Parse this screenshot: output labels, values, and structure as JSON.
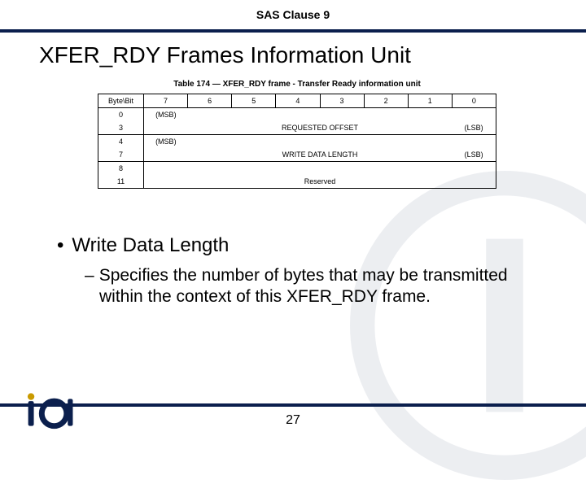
{
  "header": {
    "clause": "SAS Clause 9"
  },
  "title": "XFER_RDY Frames Information Unit",
  "table": {
    "caption": "Table 174 — XFER_RDY frame - Transfer Ready information unit",
    "corner": "Byte\\Bit",
    "bits": [
      "7",
      "6",
      "5",
      "4",
      "3",
      "2",
      "1",
      "0"
    ],
    "rows": [
      {
        "byte_start": "0",
        "byte_end": "3",
        "msb": "(MSB)",
        "field": "REQUESTED OFFSET",
        "lsb": "(LSB)"
      },
      {
        "byte_start": "4",
        "byte_end": "7",
        "msb": "(MSB)",
        "field": "WRITE DATA LENGTH",
        "lsb": "(LSB)"
      },
      {
        "byte_start": "8",
        "byte_end": "11",
        "msb": "",
        "field": "Reserved",
        "lsb": ""
      }
    ]
  },
  "bullets": {
    "b1": "Write Data Length",
    "b2": "Specifies the number of bytes that may be transmitted within the context of this XFER_RDY frame."
  },
  "footer": {
    "page": "27"
  },
  "chart_data": {
    "type": "table",
    "title": "Table 174 — XFER_RDY frame - Transfer Ready information unit",
    "columns": [
      "Byte\\Bit",
      "7",
      "6",
      "5",
      "4",
      "3",
      "2",
      "1",
      "0"
    ],
    "fields": [
      {
        "bytes": "0-3",
        "name": "REQUESTED OFFSET",
        "msb": true,
        "lsb": true
      },
      {
        "bytes": "4-7",
        "name": "WRITE DATA LENGTH",
        "msb": true,
        "lsb": true
      },
      {
        "bytes": "8-11",
        "name": "Reserved",
        "msb": false,
        "lsb": false
      }
    ]
  }
}
